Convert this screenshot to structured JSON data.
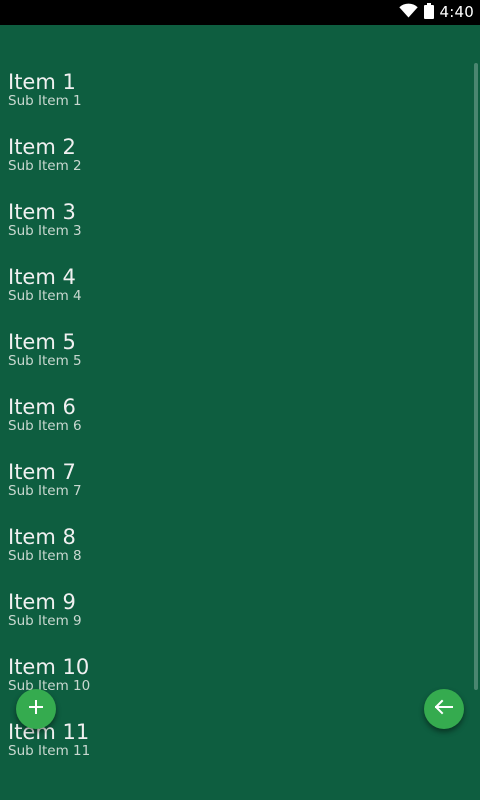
{
  "status_bar": {
    "time": "4:40",
    "icons": [
      "wifi-icon",
      "battery-icon"
    ]
  },
  "list": {
    "items": [
      {
        "title": "Item 1",
        "subtitle": "Sub Item 1"
      },
      {
        "title": "Item 2",
        "subtitle": "Sub Item 2"
      },
      {
        "title": "Item 3",
        "subtitle": "Sub Item 3"
      },
      {
        "title": "Item 4",
        "subtitle": "Sub Item 4"
      },
      {
        "title": "Item 5",
        "subtitle": "Sub Item 5"
      },
      {
        "title": "Item 6",
        "subtitle": "Sub Item 6"
      },
      {
        "title": "Item 7",
        "subtitle": "Sub Item 7"
      },
      {
        "title": "Item 8",
        "subtitle": "Sub Item 8"
      },
      {
        "title": "Item 9",
        "subtitle": "Sub Item 9"
      },
      {
        "title": "Item 10",
        "subtitle": "Sub Item 10"
      },
      {
        "title": "Item 11",
        "subtitle": "Sub Item 11"
      }
    ]
  },
  "fabs": {
    "add_icon": "plus-icon",
    "back_icon": "arrow-left-icon"
  },
  "colors": {
    "background": "#0e5e40",
    "fab": "#35ab4f",
    "status_bar": "#000000"
  }
}
